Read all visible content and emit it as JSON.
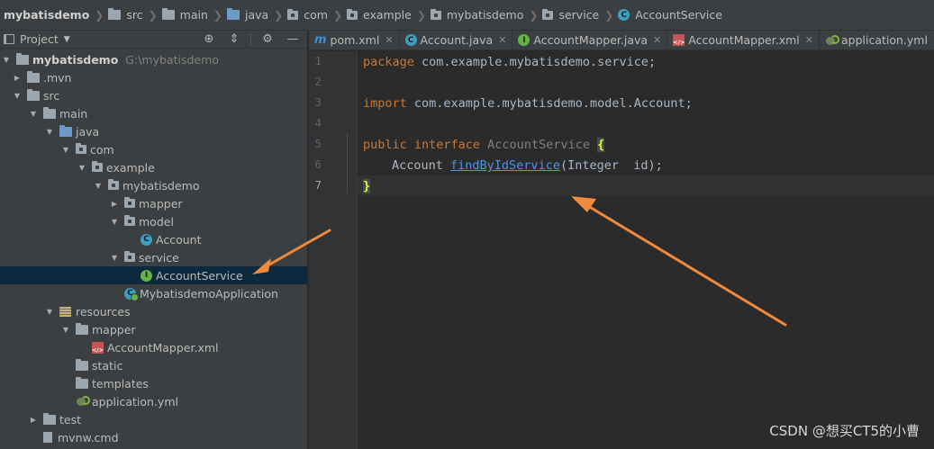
{
  "breadcrumb": {
    "project": "mybatisdemo",
    "src": "src",
    "main": "main",
    "java": "java",
    "com": "com",
    "example": "example",
    "pkg": "mybatisdemo",
    "service": "service",
    "file": "AccountService"
  },
  "project_panel": {
    "title": "Project",
    "tools": [
      "locate-icon",
      "collapse-icon",
      "gear-icon",
      "minimize-icon"
    ]
  },
  "tree": {
    "root_name": "mybatisdemo",
    "root_path": "G:\\mybatisdemo",
    "mvn": ".mvn",
    "src": "src",
    "main": "main",
    "java": "java",
    "com": "com",
    "example": "example",
    "pkg": "mybatisdemo",
    "mapper": "mapper",
    "model": "model",
    "account": "Account",
    "service": "service",
    "account_service": "AccountService",
    "application": "MybatisdemoApplication",
    "resources": "resources",
    "res_mapper": "mapper",
    "account_mapper_xml": "AccountMapper.xml",
    "static": "static",
    "templates": "templates",
    "application_yml": "application.yml",
    "test": "test",
    "mvnw_cmd": "mvnw.cmd"
  },
  "tabs": [
    {
      "label": "pom.xml",
      "icon": "maven-icon"
    },
    {
      "label": "Account.java",
      "icon": "class-icon"
    },
    {
      "label": "AccountMapper.java",
      "icon": "interface-icon"
    },
    {
      "label": "AccountMapper.xml",
      "icon": "xml-icon"
    },
    {
      "label": "application.yml",
      "icon": "yml-icon"
    }
  ],
  "editor": {
    "line_numbers": [
      "1",
      "2",
      "3",
      "4",
      "5",
      "6",
      "7"
    ],
    "l1_kw": "package",
    "l1_rest": " com.example.mybatisdemo.service;",
    "l3_kw": "import",
    "l3_rest": " com.example.mybatisdemo.model.Account;",
    "l5_kw": "public interface",
    "l5_name": " AccountService ",
    "l5_brace": "{",
    "l6_type": "Account ",
    "l6_method": "findByIdService",
    "l6_params": "(Integer  id);",
    "l7_brace": "}"
  },
  "watermark": "CSDN @想买CT5的小曹",
  "colors": {
    "annotation_arrow": "#f08a3c",
    "selection": "#0d293e",
    "keyword": "#cc7832",
    "method": "#4b95e8"
  }
}
